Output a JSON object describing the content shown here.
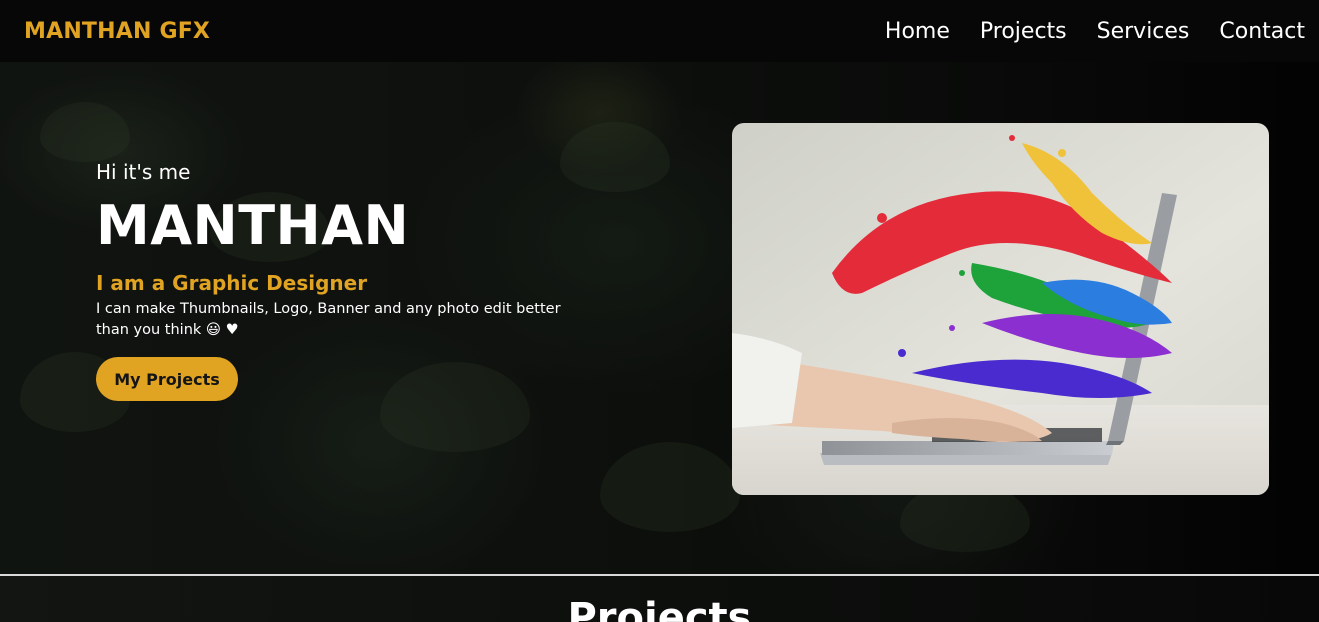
{
  "nav": {
    "brand": "MANTHAN GFX",
    "items": [
      {
        "label": "Home"
      },
      {
        "label": "Projects"
      },
      {
        "label": "Services"
      },
      {
        "label": "Contact"
      }
    ]
  },
  "hero": {
    "greeting": "Hi it's me",
    "name": "MANTHAN",
    "role": "I am a Graphic Designer",
    "description": "I can make Thumbnails, Logo, Banner and any photo edit better than you think 😃 ♥",
    "button_label": "My Projects",
    "image_icon": "laptop-paint-splash-image"
  },
  "projects": {
    "title": "Projects"
  },
  "colors": {
    "accent": "#e0a322",
    "nav_bg": "#070707",
    "text": "#ffffff"
  }
}
